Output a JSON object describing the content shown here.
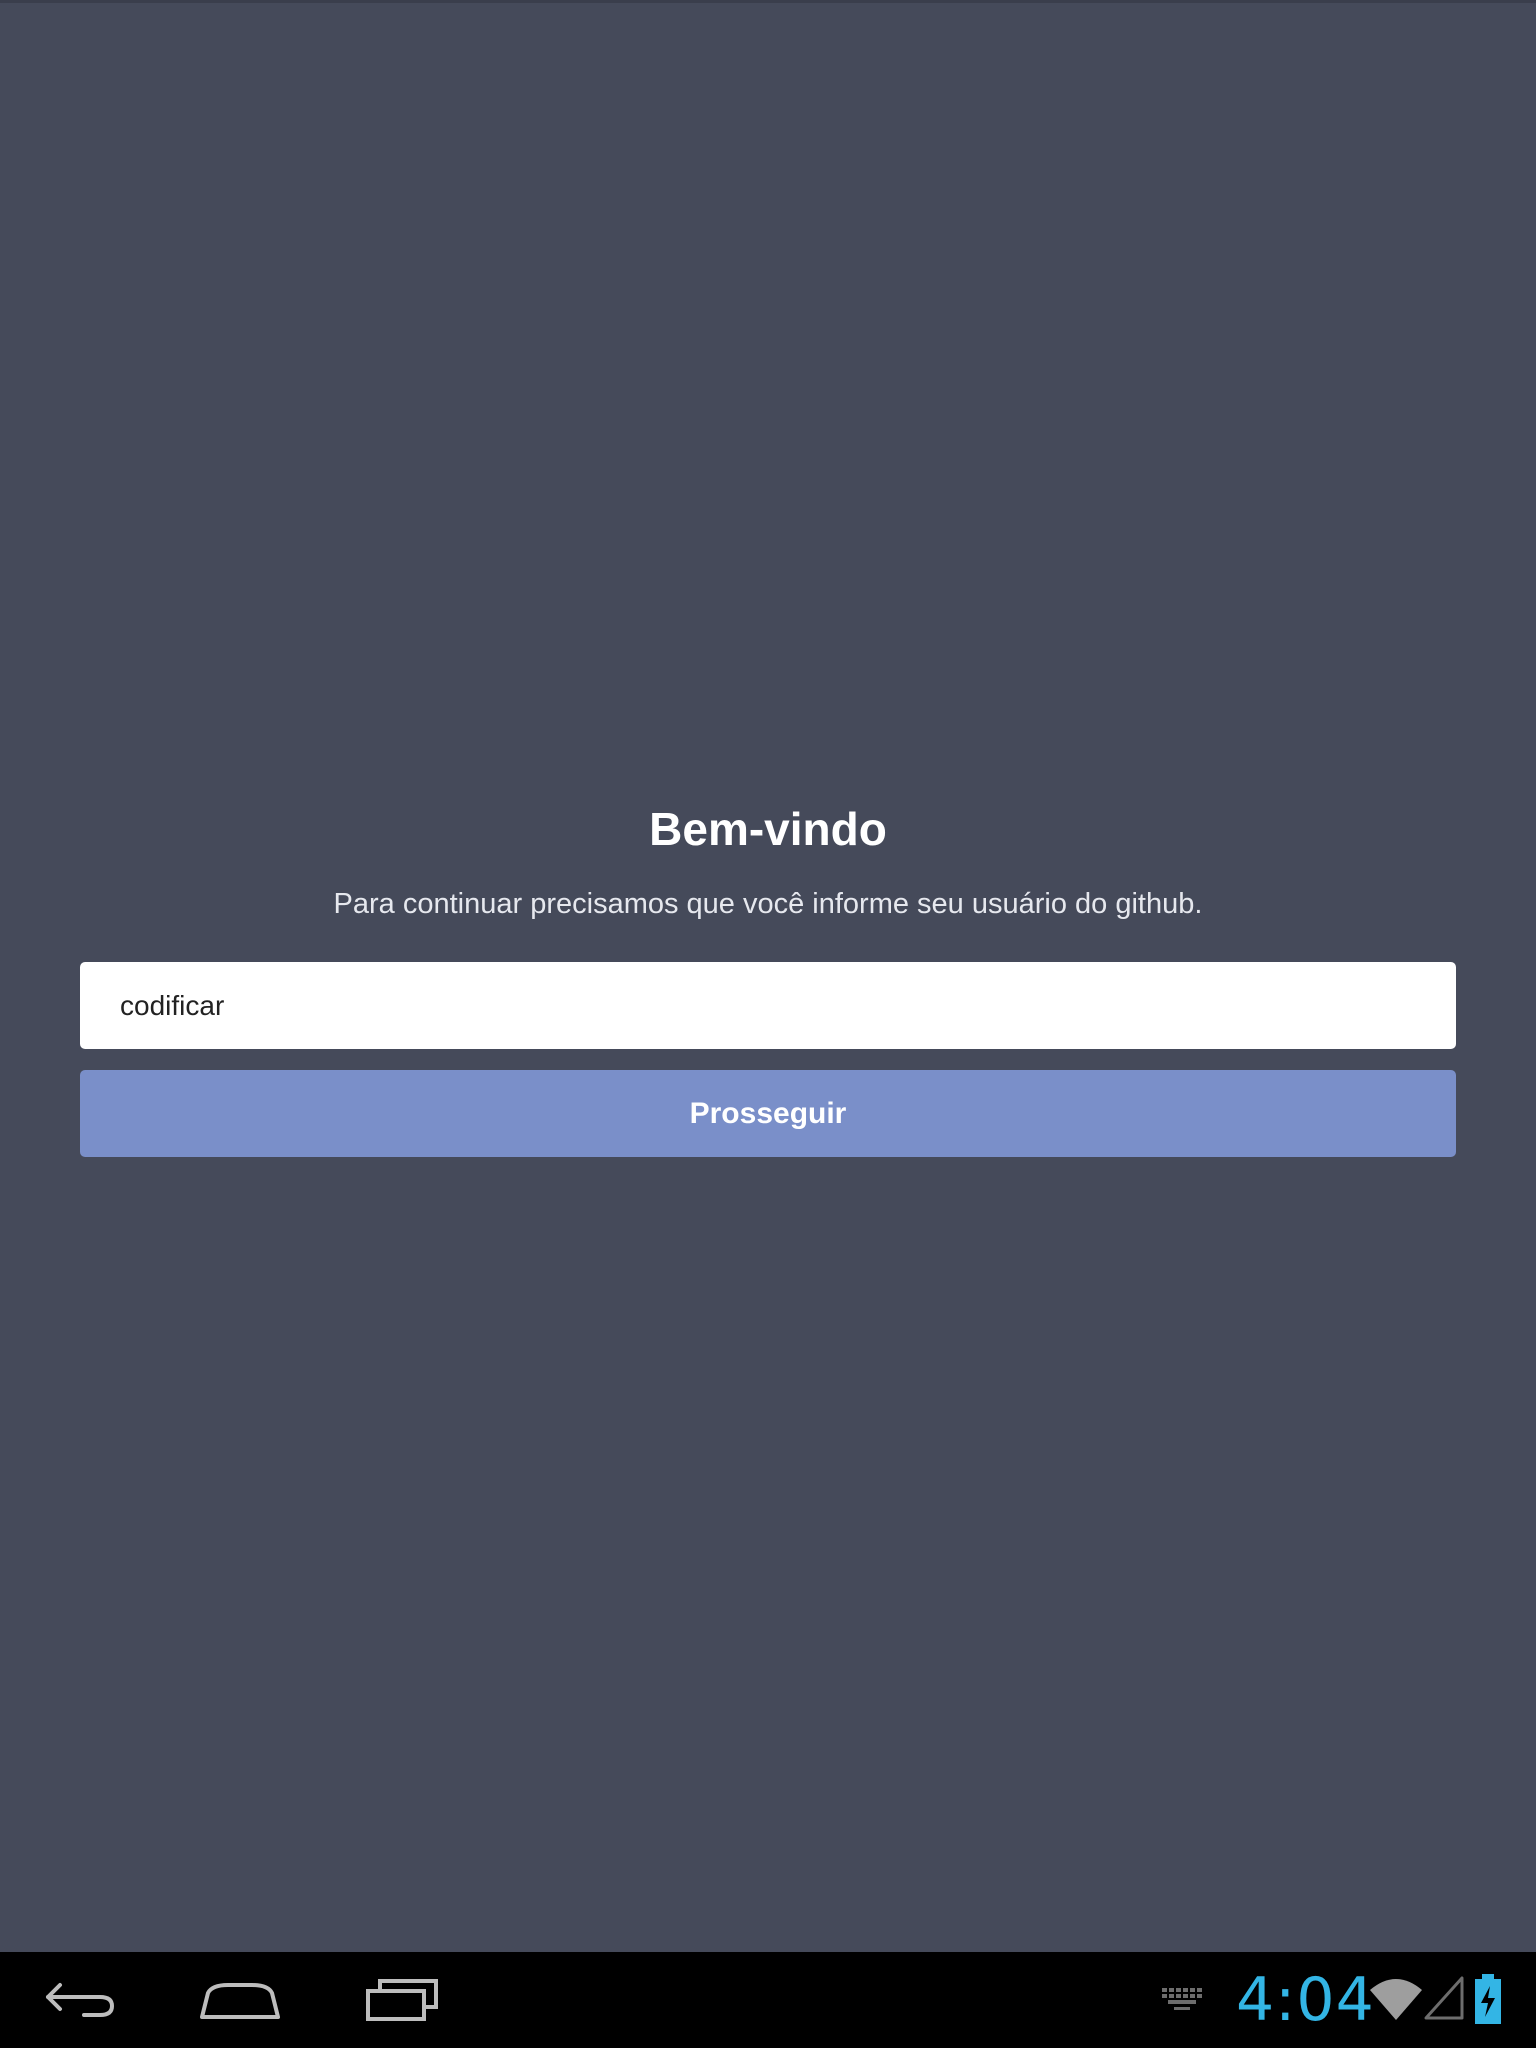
{
  "welcome": {
    "title": "Bem-vindo",
    "subtitle": "Para continuar precisamos que você informe seu usuário do github."
  },
  "form": {
    "username_value": "codificar",
    "submit_label": "Prosseguir"
  },
  "system_bar": {
    "time": "4:04",
    "icons": [
      "back-icon",
      "home-icon",
      "recent-apps-icon",
      "keyboard-icon",
      "wifi-icon",
      "cell-signal-icon",
      "battery-charging-icon"
    ]
  },
  "colors": {
    "background": "#454a5a",
    "button": "#7a8fc9",
    "clock": "#33b5e5",
    "nav_bar": "#000000"
  }
}
